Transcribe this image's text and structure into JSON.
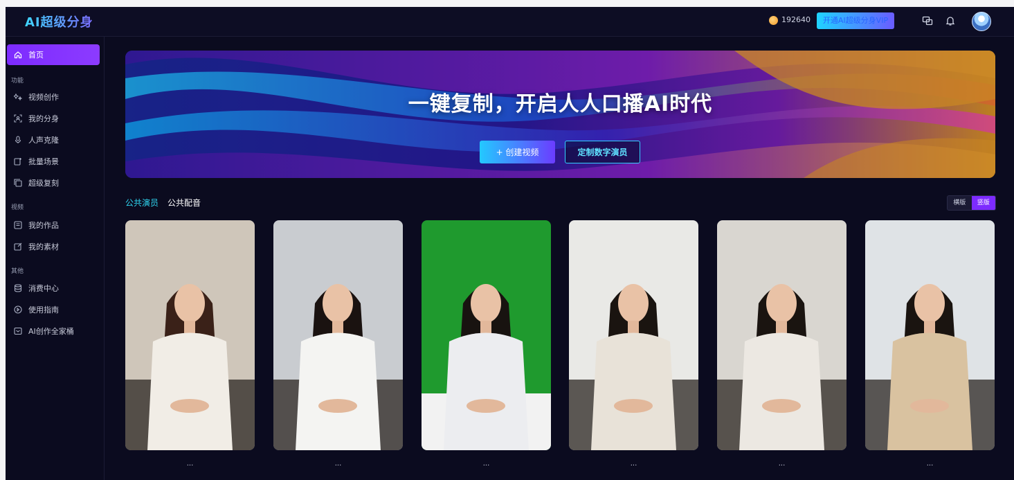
{
  "app": {
    "logo": "AI超级分身"
  },
  "header": {
    "coins": "192640",
    "vip_button": "开通AI超级分身VIP",
    "icons": [
      "screen-share-icon",
      "bell-icon",
      "avatar"
    ]
  },
  "sidebar": {
    "home": "首页",
    "sections": [
      {
        "label": "功能",
        "items": [
          "视频创作",
          "我的分身",
          "人声克隆",
          "批量场景",
          "超级复刻"
        ]
      },
      {
        "label": "视频",
        "items": [
          "我的作品",
          "我的素材"
        ]
      },
      {
        "label": "其他",
        "items": [
          "消费中心",
          "使用指南",
          "AI创作全家桶"
        ]
      }
    ]
  },
  "banner": {
    "title": "一键复制，开启人人口播AI时代",
    "create_button": "+ 创建视频",
    "custom_button": "定制数字演员"
  },
  "tabs": {
    "public_actors": "公共演员",
    "public_voices": "公共配音"
  },
  "orientation": {
    "landscape": "横版",
    "portrait": "竖版",
    "selected": "竖版"
  },
  "cards": [
    {
      "name": "...",
      "background": "#cfc6ba",
      "outfit": "#f1ede6",
      "hair": "#3a2118"
    },
    {
      "name": "...",
      "background": "#c9ccd0",
      "outfit": "#f4f4f2",
      "hair": "#1a1210"
    },
    {
      "name": "...",
      "background": "#1f9a2e",
      "outfit": "#ecedf0",
      "hair": "#181310"
    },
    {
      "name": "...",
      "background": "#e9e9e6",
      "outfit": "#e8e2d8",
      "hair": "#1a1410"
    },
    {
      "name": "...",
      "background": "#d9d6d0",
      "outfit": "#ece8e2",
      "hair": "#1a1410"
    },
    {
      "name": "...",
      "background": "#dfe3e6",
      "outfit": "#d9c2a0",
      "hair": "#1a1410"
    }
  ],
  "colors": {
    "accent": "#7d2bff",
    "cyan": "#2fd6f0",
    "bg": "#0b0b1f"
  }
}
